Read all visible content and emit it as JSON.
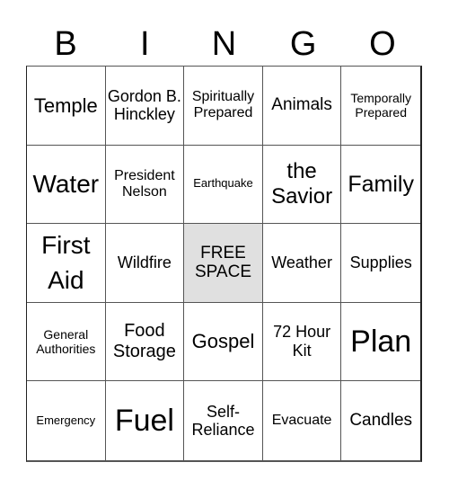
{
  "header": {
    "letters": [
      "B",
      "I",
      "N",
      "G",
      "O"
    ]
  },
  "cells": [
    {
      "text": "Temple",
      "size": "s22"
    },
    {
      "text": "Gordon B. Hinckley",
      "size": "s18"
    },
    {
      "text": "Spiritually Prepared",
      "size": "s16"
    },
    {
      "text": "Animals",
      "size": "s19"
    },
    {
      "text": "Temporally Prepared",
      "size": "s14"
    },
    {
      "text": "Water",
      "size": "s28"
    },
    {
      "text": "President Nelson",
      "size": "s16"
    },
    {
      "text": "Earthquake",
      "size": "s13"
    },
    {
      "text": "the Savior",
      "size": "s24"
    },
    {
      "text": "Family",
      "size": "s25"
    },
    {
      "text": "First Aid",
      "size": "s28"
    },
    {
      "text": "Wildfire",
      "size": "s18"
    },
    {
      "text": "FREE SPACE",
      "size": "s19",
      "free": true
    },
    {
      "text": "Weather",
      "size": "s18"
    },
    {
      "text": "Supplies",
      "size": "s18"
    },
    {
      "text": "General Authorities",
      "size": "s14"
    },
    {
      "text": "Food Storage",
      "size": "s20"
    },
    {
      "text": "Gospel",
      "size": "s22"
    },
    {
      "text": "72 Hour Kit",
      "size": "s18"
    },
    {
      "text": "Plan",
      "size": "s34"
    },
    {
      "text": "Emergency",
      "size": "s13"
    },
    {
      "text": "Fuel",
      "size": "s34"
    },
    {
      "text": "Self-Reliance",
      "size": "s18"
    },
    {
      "text": "Evacuate",
      "size": "s16"
    },
    {
      "text": "Candles",
      "size": "s19"
    }
  ],
  "colors": {
    "free_space_bg": "#e0e0e0",
    "grid_line": "#555555"
  }
}
